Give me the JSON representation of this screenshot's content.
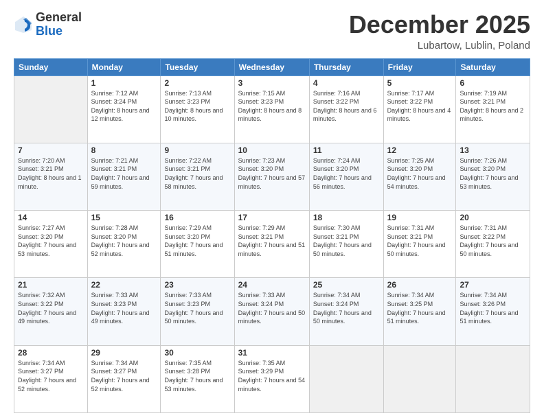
{
  "header": {
    "logo_general": "General",
    "logo_blue": "Blue",
    "month_title": "December 2025",
    "location": "Lubartow, Lublin, Poland"
  },
  "weekdays": [
    "Sunday",
    "Monday",
    "Tuesday",
    "Wednesday",
    "Thursday",
    "Friday",
    "Saturday"
  ],
  "weeks": [
    [
      {
        "day": "",
        "sunrise": "",
        "sunset": "",
        "daylight": ""
      },
      {
        "day": "1",
        "sunrise": "Sunrise: 7:12 AM",
        "sunset": "Sunset: 3:24 PM",
        "daylight": "Daylight: 8 hours and 12 minutes."
      },
      {
        "day": "2",
        "sunrise": "Sunrise: 7:13 AM",
        "sunset": "Sunset: 3:23 PM",
        "daylight": "Daylight: 8 hours and 10 minutes."
      },
      {
        "day": "3",
        "sunrise": "Sunrise: 7:15 AM",
        "sunset": "Sunset: 3:23 PM",
        "daylight": "Daylight: 8 hours and 8 minutes."
      },
      {
        "day": "4",
        "sunrise": "Sunrise: 7:16 AM",
        "sunset": "Sunset: 3:22 PM",
        "daylight": "Daylight: 8 hours and 6 minutes."
      },
      {
        "day": "5",
        "sunrise": "Sunrise: 7:17 AM",
        "sunset": "Sunset: 3:22 PM",
        "daylight": "Daylight: 8 hours and 4 minutes."
      },
      {
        "day": "6",
        "sunrise": "Sunrise: 7:19 AM",
        "sunset": "Sunset: 3:21 PM",
        "daylight": "Daylight: 8 hours and 2 minutes."
      }
    ],
    [
      {
        "day": "7",
        "sunrise": "Sunrise: 7:20 AM",
        "sunset": "Sunset: 3:21 PM",
        "daylight": "Daylight: 8 hours and 1 minute."
      },
      {
        "day": "8",
        "sunrise": "Sunrise: 7:21 AM",
        "sunset": "Sunset: 3:21 PM",
        "daylight": "Daylight: 7 hours and 59 minutes."
      },
      {
        "day": "9",
        "sunrise": "Sunrise: 7:22 AM",
        "sunset": "Sunset: 3:21 PM",
        "daylight": "Daylight: 7 hours and 58 minutes."
      },
      {
        "day": "10",
        "sunrise": "Sunrise: 7:23 AM",
        "sunset": "Sunset: 3:20 PM",
        "daylight": "Daylight: 7 hours and 57 minutes."
      },
      {
        "day": "11",
        "sunrise": "Sunrise: 7:24 AM",
        "sunset": "Sunset: 3:20 PM",
        "daylight": "Daylight: 7 hours and 56 minutes."
      },
      {
        "day": "12",
        "sunrise": "Sunrise: 7:25 AM",
        "sunset": "Sunset: 3:20 PM",
        "daylight": "Daylight: 7 hours and 54 minutes."
      },
      {
        "day": "13",
        "sunrise": "Sunrise: 7:26 AM",
        "sunset": "Sunset: 3:20 PM",
        "daylight": "Daylight: 7 hours and 53 minutes."
      }
    ],
    [
      {
        "day": "14",
        "sunrise": "Sunrise: 7:27 AM",
        "sunset": "Sunset: 3:20 PM",
        "daylight": "Daylight: 7 hours and 53 minutes."
      },
      {
        "day": "15",
        "sunrise": "Sunrise: 7:28 AM",
        "sunset": "Sunset: 3:20 PM",
        "daylight": "Daylight: 7 hours and 52 minutes."
      },
      {
        "day": "16",
        "sunrise": "Sunrise: 7:29 AM",
        "sunset": "Sunset: 3:20 PM",
        "daylight": "Daylight: 7 hours and 51 minutes."
      },
      {
        "day": "17",
        "sunrise": "Sunrise: 7:29 AM",
        "sunset": "Sunset: 3:21 PM",
        "daylight": "Daylight: 7 hours and 51 minutes."
      },
      {
        "day": "18",
        "sunrise": "Sunrise: 7:30 AM",
        "sunset": "Sunset: 3:21 PM",
        "daylight": "Daylight: 7 hours and 50 minutes."
      },
      {
        "day": "19",
        "sunrise": "Sunrise: 7:31 AM",
        "sunset": "Sunset: 3:21 PM",
        "daylight": "Daylight: 7 hours and 50 minutes."
      },
      {
        "day": "20",
        "sunrise": "Sunrise: 7:31 AM",
        "sunset": "Sunset: 3:22 PM",
        "daylight": "Daylight: 7 hours and 50 minutes."
      }
    ],
    [
      {
        "day": "21",
        "sunrise": "Sunrise: 7:32 AM",
        "sunset": "Sunset: 3:22 PM",
        "daylight": "Daylight: 7 hours and 49 minutes."
      },
      {
        "day": "22",
        "sunrise": "Sunrise: 7:33 AM",
        "sunset": "Sunset: 3:23 PM",
        "daylight": "Daylight: 7 hours and 49 minutes."
      },
      {
        "day": "23",
        "sunrise": "Sunrise: 7:33 AM",
        "sunset": "Sunset: 3:23 PM",
        "daylight": "Daylight: 7 hours and 50 minutes."
      },
      {
        "day": "24",
        "sunrise": "Sunrise: 7:33 AM",
        "sunset": "Sunset: 3:24 PM",
        "daylight": "Daylight: 7 hours and 50 minutes."
      },
      {
        "day": "25",
        "sunrise": "Sunrise: 7:34 AM",
        "sunset": "Sunset: 3:24 PM",
        "daylight": "Daylight: 7 hours and 50 minutes."
      },
      {
        "day": "26",
        "sunrise": "Sunrise: 7:34 AM",
        "sunset": "Sunset: 3:25 PM",
        "daylight": "Daylight: 7 hours and 51 minutes."
      },
      {
        "day": "27",
        "sunrise": "Sunrise: 7:34 AM",
        "sunset": "Sunset: 3:26 PM",
        "daylight": "Daylight: 7 hours and 51 minutes."
      }
    ],
    [
      {
        "day": "28",
        "sunrise": "Sunrise: 7:34 AM",
        "sunset": "Sunset: 3:27 PM",
        "daylight": "Daylight: 7 hours and 52 minutes."
      },
      {
        "day": "29",
        "sunrise": "Sunrise: 7:34 AM",
        "sunset": "Sunset: 3:27 PM",
        "daylight": "Daylight: 7 hours and 52 minutes."
      },
      {
        "day": "30",
        "sunrise": "Sunrise: 7:35 AM",
        "sunset": "Sunset: 3:28 PM",
        "daylight": "Daylight: 7 hours and 53 minutes."
      },
      {
        "day": "31",
        "sunrise": "Sunrise: 7:35 AM",
        "sunset": "Sunset: 3:29 PM",
        "daylight": "Daylight: 7 hours and 54 minutes."
      },
      {
        "day": "",
        "sunrise": "",
        "sunset": "",
        "daylight": ""
      },
      {
        "day": "",
        "sunrise": "",
        "sunset": "",
        "daylight": ""
      },
      {
        "day": "",
        "sunrise": "",
        "sunset": "",
        "daylight": ""
      }
    ]
  ]
}
